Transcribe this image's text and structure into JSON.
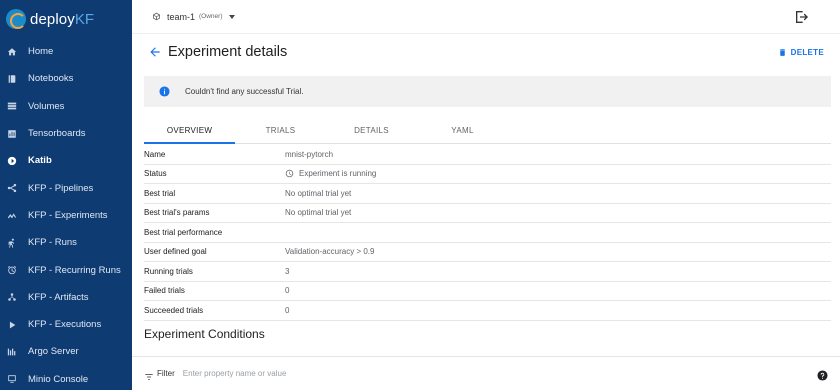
{
  "app": {
    "logo_main": "deploy",
    "logo_accent": "KF"
  },
  "sidebar": {
    "items": [
      {
        "label": "Home",
        "icon": "home-icon",
        "active": false
      },
      {
        "label": "Notebooks",
        "icon": "notebook-icon",
        "active": false
      },
      {
        "label": "Volumes",
        "icon": "volumes-icon",
        "active": false
      },
      {
        "label": "Tensorboards",
        "icon": "tensorboard-icon",
        "active": false
      },
      {
        "label": "Katib",
        "icon": "katib-icon",
        "active": true
      },
      {
        "label": "KFP - Pipelines",
        "icon": "pipelines-icon",
        "active": false
      },
      {
        "label": "KFP - Experiments",
        "icon": "experiments-icon",
        "active": false
      },
      {
        "label": "KFP - Runs",
        "icon": "runs-icon",
        "active": false
      },
      {
        "label": "KFP - Recurring Runs",
        "icon": "recurring-runs-icon",
        "active": false
      },
      {
        "label": "KFP - Artifacts",
        "icon": "artifacts-icon",
        "active": false
      },
      {
        "label": "KFP - Executions",
        "icon": "executions-icon",
        "active": false
      },
      {
        "label": "Argo Server",
        "icon": "argo-icon",
        "active": false
      },
      {
        "label": "Minio Console",
        "icon": "minio-icon",
        "active": false
      }
    ]
  },
  "topbar": {
    "namespace": "team-1",
    "namespace_role": "(Owner)"
  },
  "header": {
    "title": "Experiment details",
    "delete_label": "DELETE"
  },
  "banner": {
    "message": "Couldn't find any successful Trial."
  },
  "tabs": [
    {
      "label": "OVERVIEW",
      "active": true
    },
    {
      "label": "TRIALS",
      "active": false
    },
    {
      "label": "DETAILS",
      "active": false
    },
    {
      "label": "YAML",
      "active": false
    }
  ],
  "details": {
    "rows": [
      {
        "key": "Name",
        "value": "mnist-pytorch"
      },
      {
        "key": "Status",
        "value": "Experiment is running"
      },
      {
        "key": "Best trial",
        "value": "No optimal trial yet"
      },
      {
        "key": "Best trial's params",
        "value": "No optimal trial yet"
      },
      {
        "key": "Best trial performance",
        "value": ""
      },
      {
        "key": "User defined goal",
        "value": "Validation-accuracy > 0.9"
      },
      {
        "key": "Running trials",
        "value": "3"
      },
      {
        "key": "Failed trials",
        "value": "0"
      },
      {
        "key": "Succeeded trials",
        "value": "0"
      }
    ]
  },
  "conditions": {
    "title": "Experiment Conditions"
  },
  "filter": {
    "label": "Filter",
    "placeholder": "Enter property name or value"
  },
  "colors": {
    "sidebar_bg": "#0f3b73",
    "accent": "#1a73e8",
    "banner_bg": "#f1f1f1"
  }
}
